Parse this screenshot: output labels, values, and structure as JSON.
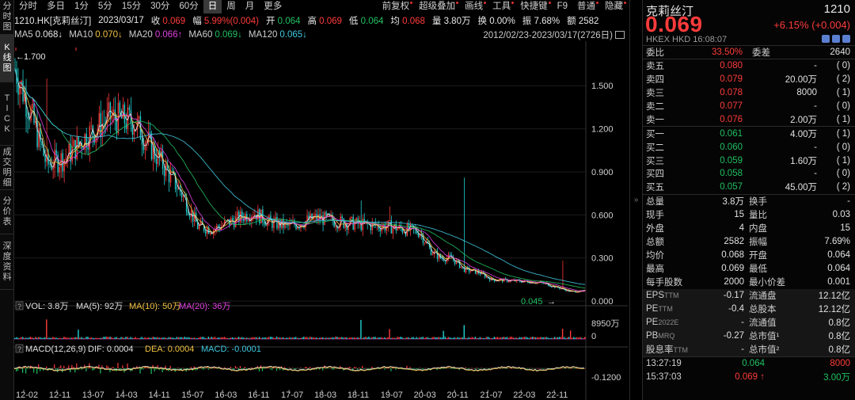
{
  "left_tabs": [
    "分时图",
    "K线图",
    "TICK",
    "成交明细",
    "分价表",
    "深度资料"
  ],
  "toolbar": {
    "periods": [
      "分时",
      "多日",
      "1分",
      "5分",
      "15分",
      "30分",
      "60分",
      "日",
      "周",
      "月",
      "更多"
    ],
    "active_period": "日",
    "right_items": [
      "前复权",
      "超级叠加",
      "画线",
      "工具",
      "快捷键",
      "F9",
      "普通",
      "隐藏"
    ]
  },
  "quote": {
    "symbol": "1210.HK[克莉丝汀]",
    "date": "2023/03/17",
    "close_label": "收",
    "close": "0.069",
    "change_label": "幅",
    "change": "5.99%(0.004)",
    "open_label": "开",
    "open": "0.064",
    "high_label": "高",
    "high": "0.069",
    "low_label": "低",
    "low": "0.064",
    "avg_label": "均",
    "avg": "0.068",
    "volume_label": "量",
    "volume": "3.80万",
    "turnover_label": "换",
    "turnover": "0.00%",
    "amplitude_label": "振",
    "amplitude": "7.68%",
    "amount_label": "额",
    "amount": "2582"
  },
  "ma": [
    {
      "label": "MA5",
      "value": "0.068↓",
      "color": "#e8e8e8"
    },
    {
      "label": "MA10",
      "value": "0.070↓",
      "color": "#f0c040"
    },
    {
      "label": "MA20",
      "value": "0.066↑",
      "color": "#e040e0"
    },
    {
      "label": "MA60",
      "value": "0.069↓",
      "color": "#20c060"
    },
    {
      "label": "MA120",
      "value": "0.065↓",
      "color": "#40c8e0"
    }
  ],
  "range_text": "2012/02/23-2023/03/17(2726日)",
  "price_chart": {
    "y_ticks": [
      "1.500",
      "1.200",
      "0.900",
      "0.600",
      "0.300",
      "0.000"
    ],
    "max_label": "1.700",
    "min_label": "0.045"
  },
  "volume_bar": {
    "q": "?",
    "vol": "VOL: 3.8万",
    "ma5": "MA(5): 92万",
    "ma10": "MA(10): 50万",
    "ma20": "MA(20): 36万",
    "y_top": "8950万",
    "y_zero": "0"
  },
  "macd_bar": {
    "q": "?",
    "macd": "MACD(12,26,9)",
    "dif": "DIF: 0.0004",
    "dea": "DEA: 0.0004",
    "macd_val": "MACD: -0.0001",
    "y_label": "-0.1200"
  },
  "x_ticks": [
    "12-02",
    "12-11",
    "13-07",
    "14-03",
    "14-11",
    "15-07",
    "16-03",
    "16-11",
    "17-07",
    "18-03",
    "18-11",
    "19-07",
    "20-03",
    "20-11",
    "21-07",
    "22-03",
    "22-11"
  ],
  "chart_data": {
    "type": "candlestick",
    "title": "1210.HK[克莉丝汀]",
    "x": [
      "12-02",
      "12-11",
      "13-07",
      "14-03",
      "14-11",
      "15-07",
      "16-03",
      "16-11",
      "17-07",
      "18-03",
      "18-11",
      "19-07",
      "20-03",
      "20-11",
      "21-07",
      "22-03",
      "22-11",
      "23-03"
    ],
    "close_approx": [
      1.55,
      1.25,
      1.2,
      0.55,
      0.52,
      0.65,
      0.55,
      0.55,
      0.52,
      0.5,
      0.45,
      0.3,
      0.2,
      0.15,
      0.13,
      0.1,
      0.06,
      0.069
    ],
    "ylim": [
      0.0,
      1.7
    ],
    "max": 1.7,
    "min": 0.045
  },
  "right": {
    "name": "克莉丝汀",
    "code": "1210",
    "price": "0.069",
    "change": "+6.15% (+0.004)",
    "meta": "HKEX  HKD  16:08:07",
    "ratio": {
      "label": "委比",
      "value": "33.50%",
      "diff_label": "委差",
      "diff": "2640"
    },
    "asks": [
      {
        "label": "卖五",
        "price": "0.080",
        "vol": "-",
        "n": "( 0)"
      },
      {
        "label": "卖四",
        "price": "0.079",
        "vol": "20.00万",
        "n": "( 2)"
      },
      {
        "label": "卖三",
        "price": "0.078",
        "vol": "8000",
        "n": "( 1)"
      },
      {
        "label": "卖二",
        "price": "0.077",
        "vol": "-",
        "n": "( 0)"
      },
      {
        "label": "卖一",
        "price": "0.076",
        "vol": "2.00万",
        "n": "( 1)"
      }
    ],
    "bids": [
      {
        "label": "买一",
        "price": "0.061",
        "vol": "4.00万",
        "n": "( 1)"
      },
      {
        "label": "买二",
        "price": "0.060",
        "vol": "-",
        "n": "( 0)"
      },
      {
        "label": "买三",
        "price": "0.059",
        "vol": "1.60万",
        "n": "( 1)"
      },
      {
        "label": "买四",
        "price": "0.058",
        "vol": "-",
        "n": "( 0)"
      },
      {
        "label": "买五",
        "price": "0.057",
        "vol": "45.00万",
        "n": "( 2)"
      }
    ],
    "stats": [
      {
        "l1": "总量",
        "v1": "3.8万",
        "l2": "换手",
        "v2": "-",
        "c1": "white",
        "c2": "white"
      },
      {
        "l1": "现手",
        "v1": "15",
        "l2": "量比",
        "v2": "0.03",
        "c1": "white",
        "c2": "white"
      },
      {
        "l1": "外盘",
        "v1": "4",
        "l2": "内盘",
        "v2": "15",
        "c1": "red",
        "c2": "green"
      },
      {
        "l1": "总额",
        "v1": "2582",
        "l2": "振幅",
        "v2": "7.69%",
        "c1": "white",
        "c2": "white"
      },
      {
        "l1": "均价",
        "v1": "0.068",
        "l2": "开盘",
        "v2": "0.064",
        "c1": "red",
        "c2": "green"
      },
      {
        "l1": "最高",
        "v1": "0.069",
        "l2": "最低",
        "v2": "0.064",
        "c1": "red",
        "c2": "green"
      },
      {
        "l1": "每手股数",
        "v1": "2000",
        "l2": "最小价差",
        "v2": "0.001",
        "c1": "white",
        "c2": "white"
      },
      {
        "l1": "EPS",
        "s1": "TTM",
        "v1": "-0.17",
        "l2": "流通盘",
        "v2": "12.12亿",
        "c1": "white",
        "c2": "white"
      },
      {
        "l1": "PE",
        "s1": "TTM",
        "v1": "-0.4",
        "l2": "总股本",
        "v2": "12.12亿",
        "c1": "white",
        "c2": "white"
      },
      {
        "l1": "PE",
        "s1": "2022E",
        "v1": "-",
        "l2": "流通值",
        "v2": "0.8亿",
        "c1": "white",
        "c2": "white"
      },
      {
        "l1": "PB",
        "s1": "MRQ",
        "v1": "-0.27",
        "l2": "总市值¹",
        "v2": "0.8亿",
        "c1": "white",
        "c2": "white"
      },
      {
        "l1": "股息率",
        "s1": "TTM",
        "v1": "-",
        "l2": "总市值²",
        "v2": "0.8亿",
        "c1": "white",
        "c2": "white"
      }
    ],
    "trades": [
      {
        "time": "13:27:19",
        "price": "0.064",
        "vol": "8000",
        "pc": "green",
        "vc": "red"
      },
      {
        "time": "15:37:03",
        "price": "0.069 ↑",
        "vol": "3.00万",
        "pc": "red",
        "vc": "green"
      }
    ]
  }
}
